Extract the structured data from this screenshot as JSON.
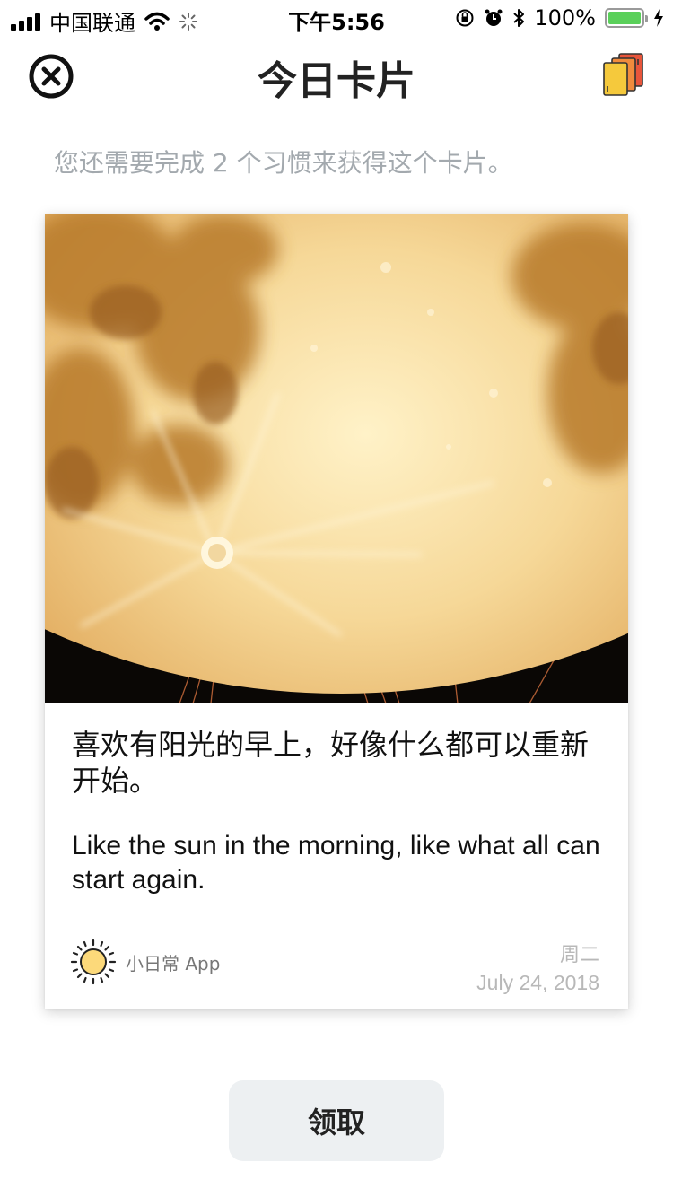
{
  "status_bar": {
    "carrier": "中国联通",
    "time": "下午5:56",
    "battery_percent": "100%",
    "battery_level": 1.0,
    "icons": [
      "signal-icon",
      "wifi-icon",
      "loading-icon",
      "orientation-lock-icon",
      "alarm-icon",
      "bluetooth-icon",
      "battery-icon",
      "charging-icon"
    ]
  },
  "header": {
    "title": "今日卡片",
    "close_icon": "close-circle-icon",
    "cards_icon": "cards-stack-icon"
  },
  "subtitle": "您还需要完成 2 个习惯来获得这个卡片。",
  "card": {
    "image": "full-moon-photo",
    "quote_cn": "喜欢有阳光的早上，好像什么都可以重新开始。",
    "quote_en": "Like the sun in the morning, like what all can start again.",
    "brand_icon": "sun-icon",
    "brand_name": "小日常 App",
    "weekday": "周二",
    "date": "July 24, 2018"
  },
  "claim_button_label": "领取",
  "colors": {
    "subtitle": "#a3a9ae",
    "button_bg": "#edf0f2",
    "battery_fill": "#5ad05a",
    "moon": "#f4d18c"
  }
}
